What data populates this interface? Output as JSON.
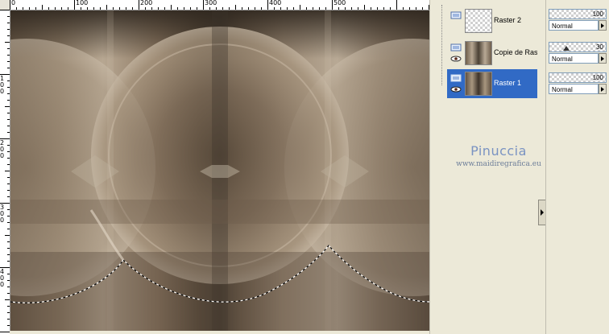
{
  "ruler": {
    "top_labels": [
      "0",
      "100",
      "200",
      "300",
      "400",
      "500"
    ],
    "left_labels": [
      "100",
      "200",
      "300",
      "400"
    ]
  },
  "layers": [
    {
      "name": "Raster 2",
      "selected": false,
      "thumb": "checker"
    },
    {
      "name": "Copie de Ras",
      "selected": false,
      "thumb": "image"
    },
    {
      "name": "Raster 1",
      "selected": true,
      "thumb": "image"
    }
  ],
  "properties": [
    {
      "opacity": "100",
      "blend_mode": "Normal"
    },
    {
      "opacity": "30",
      "blend_mode": "Normal"
    },
    {
      "opacity": "100",
      "blend_mode": "Normal"
    }
  ],
  "watermark": {
    "name": "Pinuccia",
    "url": "www.maidiregrafica.eu"
  },
  "colors": {
    "selection": "#316ac5",
    "panel_bg": "#ece9d8",
    "watermark": "#7a93c2"
  },
  "icons": [
    "layer-visibility-icon",
    "eye-icon",
    "expand-arrow-icon",
    "dropdown-arrow-icon",
    "slider-thumb-icon"
  ]
}
